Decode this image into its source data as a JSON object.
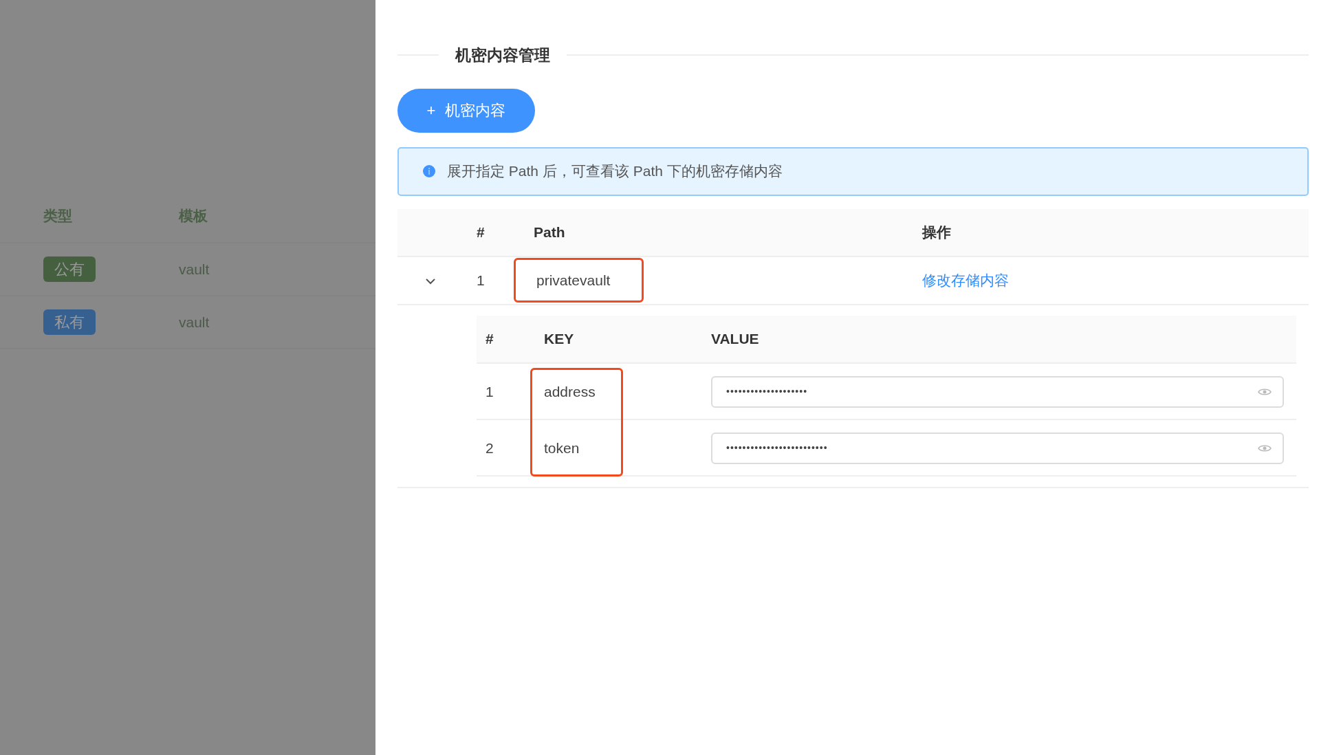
{
  "background_table": {
    "columns": [
      "类型",
      "模板"
    ],
    "rows": [
      {
        "type": "公有",
        "color": "#44603f",
        "template": "vault"
      },
      {
        "type": "私有",
        "color": "#35608f",
        "template": "vault"
      }
    ]
  },
  "drawer": {
    "section_title": "机密内容管理",
    "add_button": {
      "icon": "+",
      "label": "机密内容"
    },
    "alert": "展开指定 Path 后，可查看该 Path 下的机密存储内容",
    "table": {
      "columns": [
        "#",
        "Path",
        "操作"
      ],
      "rows": [
        {
          "index": "1",
          "path": "privatevault",
          "highlighted": true,
          "expanded": true,
          "action": "修改存储内容",
          "secrets": {
            "columns": [
              "#",
              "KEY",
              "VALUE"
            ],
            "key_column_highlighted": true,
            "rows": [
              {
                "index": "1",
                "key": "address",
                "value": "••••••••••••••••••••"
              },
              {
                "index": "2",
                "key": "token",
                "value": "•••••••••••••••••••••••••"
              }
            ]
          }
        }
      ]
    }
  }
}
